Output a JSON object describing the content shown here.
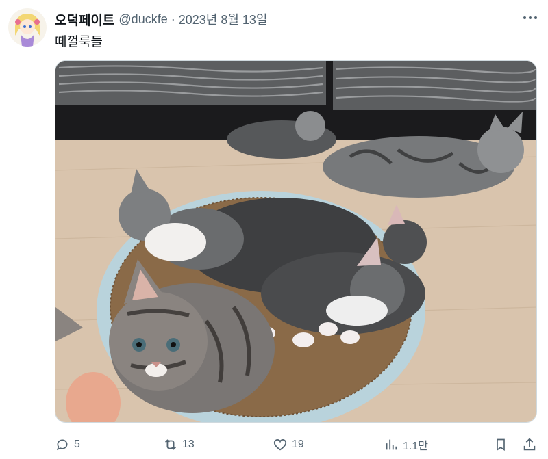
{
  "tweet": {
    "display_name": "오덕페이트",
    "handle": "@duckfe",
    "separator": "·",
    "date": "2023년 8월 13일",
    "text": "떼껄룩들"
  },
  "actions": {
    "replies": "5",
    "retweets": "13",
    "likes": "19",
    "views": "1.1만"
  },
  "icons": {
    "reply": "reply-icon",
    "retweet": "retweet-icon",
    "like": "heart-icon",
    "views": "views-chart-icon",
    "bookmark": "bookmark-icon",
    "share": "share-icon",
    "more": "more-dots-icon"
  },
  "colors": {
    "text": "#0f1419",
    "muted": "#536471",
    "border": "#cfd9de"
  }
}
